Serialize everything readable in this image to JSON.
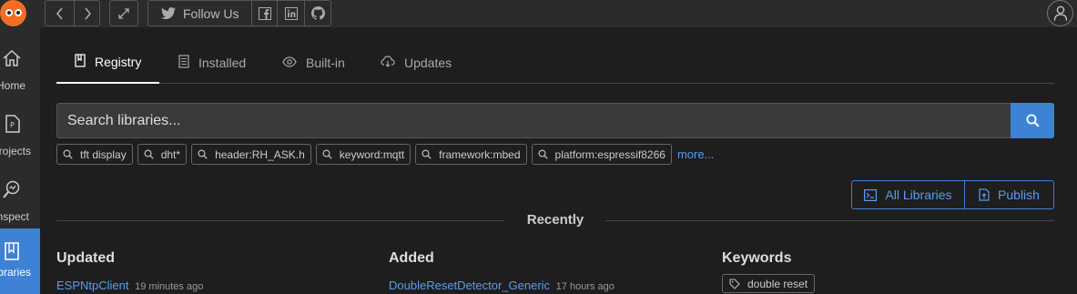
{
  "topbar": {
    "follow_label": "Follow Us"
  },
  "sidebar": {
    "items": [
      {
        "label": "Home",
        "icon": "home-icon"
      },
      {
        "label": "Projects",
        "icon": "project-file-icon"
      },
      {
        "label": "Inspect",
        "icon": "inspect-icon"
      },
      {
        "label": "Libraries",
        "icon": "book-icon",
        "active": true
      }
    ]
  },
  "tabs": [
    {
      "label": "Registry",
      "icon": "bookmark-icon",
      "active": true
    },
    {
      "label": "Installed",
      "icon": "list-icon"
    },
    {
      "label": "Built-in",
      "icon": "eye-icon"
    },
    {
      "label": "Updates",
      "icon": "cloud-download-icon"
    }
  ],
  "search": {
    "placeholder": "Search libraries..."
  },
  "chips": [
    "tft display",
    "dht*",
    "header:RH_ASK.h",
    "keyword:mqtt",
    "framework:mbed",
    "platform:espressif8266"
  ],
  "more_label": "more...",
  "actions": {
    "all_libraries": "All Libraries",
    "publish": "Publish"
  },
  "recently": {
    "title": "Recently",
    "updated": {
      "heading": "Updated",
      "items": [
        {
          "name": "ESPNtpClient",
          "ago": "19 minutes ago"
        }
      ]
    },
    "added": {
      "heading": "Added",
      "items": [
        {
          "name": "DoubleResetDetector_Generic",
          "ago": "17 hours ago"
        }
      ]
    },
    "keywords": {
      "heading": "Keywords",
      "items": [
        "double reset"
      ]
    }
  },
  "colors": {
    "accent": "#3d82d4",
    "link": "#5a9cf0",
    "background": "#1e1e1e",
    "panel": "#2b2b2b",
    "brand": "#f36e24"
  }
}
